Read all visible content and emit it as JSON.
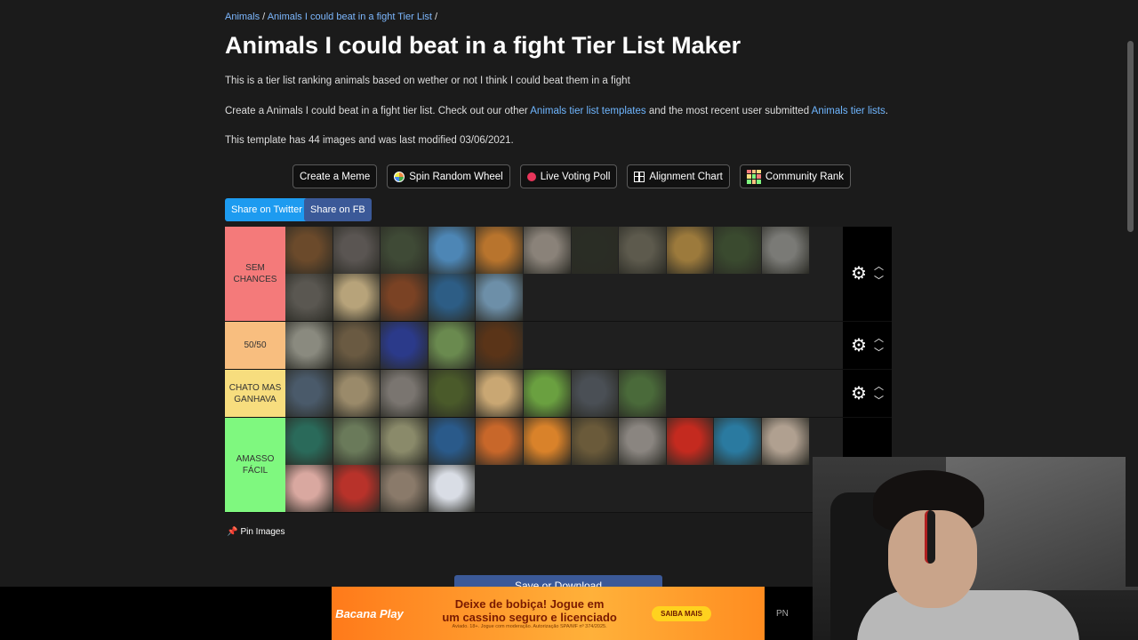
{
  "breadcrumb": {
    "item1": "Animals",
    "sep1": " / ",
    "item2": "Animals I could beat in a fight Tier List",
    "sep2": " /"
  },
  "page_title": "Animals I could beat in a fight Tier List Maker",
  "description": "This is a tier list ranking animals based on wether or not I think I could beat them in a fight",
  "intro": {
    "text1": "Create a Animals I could beat in a fight tier list. Check out our other ",
    "link1": "Animals tier list templates",
    "text2": " and the most recent user submitted ",
    "link2": "Animals tier lists",
    "text3": "."
  },
  "template_info": "This template has 44 images and was last modified 03/06/2021.",
  "tools": {
    "meme": "Create a Meme",
    "wheel": "Spin Random Wheel",
    "poll": "Live Voting Poll",
    "alignment": "Alignment Chart",
    "community": "Community Rank"
  },
  "share": {
    "twitter": "Share on Twitter",
    "facebook": "Share on FB"
  },
  "tiers": [
    {
      "label": "SEM CHANCES",
      "color": "#f47a7a",
      "items": [
        "bear",
        "hippo",
        "crocodile",
        "shark",
        "tiger",
        "wolf",
        "gorilla",
        "komodo-dragon",
        "lion",
        "panda",
        "rhino",
        "elephant",
        "cheetah",
        "horse",
        "whale",
        "dolphin"
      ]
    },
    {
      "label": "50/50",
      "color": "#f8be7f",
      "items": [
        "zebra",
        "deer",
        "octopus",
        "cow",
        "orangutan"
      ]
    },
    {
      "label": "CHATO MAS GANHAVA",
      "color": "#f7dd7e",
      "items": [
        "eagle",
        "llama",
        "cat",
        "snake",
        "dog",
        "lizard",
        "sea-lion",
        "goat"
      ]
    },
    {
      "label": "AMASSO FÁCIL",
      "color": "#7ff87f",
      "items": [
        "peacock",
        "duck",
        "sheep",
        "clownfish",
        "crab",
        "oriole",
        "starfish",
        "ferret",
        "lobster",
        "turtle",
        "mouse",
        "squid",
        "parrot",
        "owl",
        "swan"
      ]
    }
  ],
  "tile_colors": {
    "bear": "#6b4a2b",
    "hippo": "#5a5552",
    "crocodile": "#3f4a36",
    "shark": "#4d86b5",
    "tiger": "#b8742d",
    "wolf": "#8a8279",
    "gorilla": "#2a2d25",
    "komodo-dragon": "#5d5a4d",
    "lion": "#9c7a3c",
    "panda": "#3a4a2f",
    "rhino": "#7a7a76",
    "elephant": "#5a5751",
    "cheetah": "#b7a37a",
    "horse": "#7a4224",
    "whale": "#2d5d85",
    "dolphin": "#6d8fa8",
    "zebra": "#8a8a7f",
    "deer": "#6a5a42",
    "octopus": "#2b3a8a",
    "cow": "#6a8a4f",
    "orangutan": "#5a3418",
    "eagle": "#4a5a6a",
    "llama": "#9a8a6a",
    "cat": "#7a7570",
    "snake": "#4a5a2a",
    "dog": "#c9a773",
    "lizard": "#6aa040",
    "sea-lion": "#4a4f55",
    "goat": "#4a6a3a",
    "peacock": "#2a6a5a",
    "duck": "#6a7a5a",
    "sheep": "#8a8a6a",
    "clownfish": "#2a5a8a",
    "crab": "#c8672a",
    "oriole": "#d9822a",
    "starfish": "#6a5a3a",
    "ferret": "#8a8580",
    "lobster": "#c42a1f",
    "turtle": "#2a7aa0",
    "mouse": "#b0a090",
    "squid": "#d9a8a0",
    "parrot": "#b8322a",
    "owl": "#8a7a6a",
    "swan": "#d9dde5"
  },
  "pin_images": "Pin Images",
  "save_button": "Save or Download",
  "ad": {
    "brand": "Bacana Play",
    "headline_1": "Deixe de bobiça! Jogue em",
    "headline_2": "um cassino seguro e licenciado",
    "fine_print": "Aviado. 18+. Jogue com moderação. Autorização SPA/MF nº 374/2025.",
    "cta": "SAIBA MAIS",
    "side_label": "PN"
  }
}
